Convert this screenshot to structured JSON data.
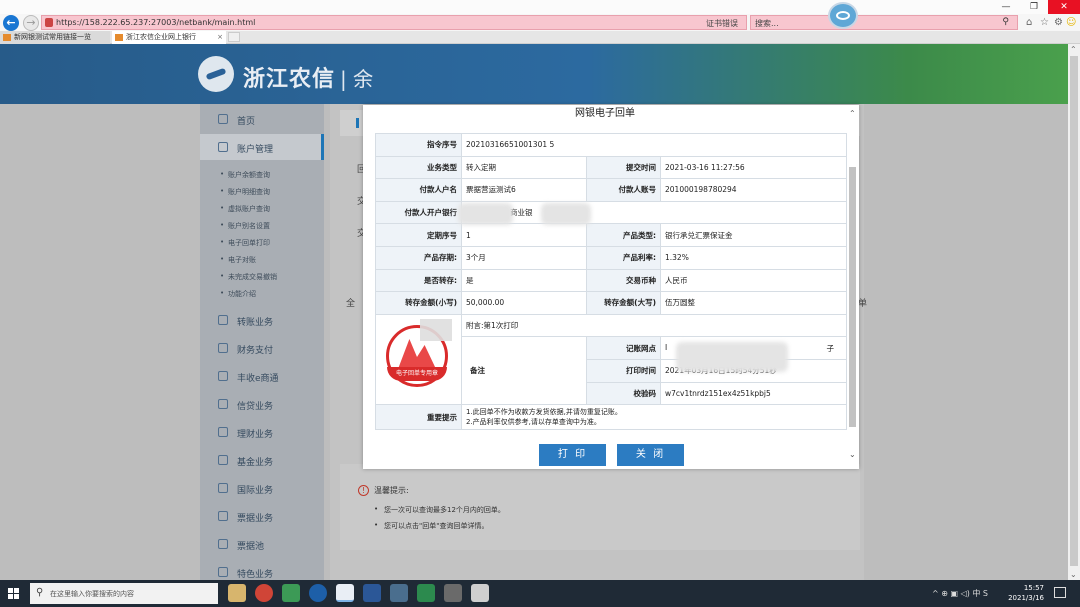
{
  "browser": {
    "url": "https://158.222.65.237:27003/netbank/main.html",
    "cert_text": "证书错误",
    "search_placeholder": "搜索...",
    "tabs": [
      {
        "label": "新网银测试常用链接一览"
      },
      {
        "label": "浙江农信企业网上银行"
      }
    ],
    "window_controls": {
      "min": "—",
      "max": "❐",
      "close": "✕"
    }
  },
  "header": {
    "brand": "浙江农信",
    "sep": "| 余"
  },
  "sidebar": {
    "items": [
      {
        "label": "首页",
        "icon": "home-icon"
      },
      {
        "label": "账户管理",
        "icon": "account-icon",
        "active": true
      },
      {
        "label": "转账业务",
        "icon": "transfer-icon"
      },
      {
        "label": "财务支付",
        "icon": "payment-icon"
      },
      {
        "label": "丰收e商通",
        "icon": "ecommerce-icon"
      },
      {
        "label": "信贷业务",
        "icon": "loan-icon"
      },
      {
        "label": "理财业务",
        "icon": "wealth-icon"
      },
      {
        "label": "基金业务",
        "icon": "fund-icon"
      },
      {
        "label": "国际业务",
        "icon": "globe-icon"
      },
      {
        "label": "票据业务",
        "icon": "bill-icon"
      },
      {
        "label": "票据池",
        "icon": "bill-pool-icon"
      },
      {
        "label": "特色业务",
        "icon": "feature-icon"
      }
    ],
    "subitems": [
      "账户余额查询",
      "账户明细查询",
      "虚拟账户查询",
      "账户别名设置",
      "电子回单打印",
      "电子对账",
      "未完成交易撤销",
      "功能介绍"
    ]
  },
  "background": {
    "labels": [
      "回",
      "交",
      "交",
      "全",
      "单"
    ]
  },
  "tips": {
    "title": "温馨提示:",
    "lines": [
      "您一次可以查询最多12个月内的回单。",
      "您可以点击\"回单\"查询回单详情。"
    ]
  },
  "modal": {
    "title": "网银电子回单",
    "rows": {
      "instr_no_label": "指令序号",
      "instr_no": "20210316651001301 5",
      "biz_type_label": "业务类型",
      "biz_type": "转入定期",
      "submit_time_label": "提交时间",
      "submit_time": "2021-03-16 11:27:56",
      "payer_name_label": "付款人户名",
      "payer_name": "票据营运测试6",
      "payer_acct_label": "付款人账号",
      "payer_acct": "201000198780294",
      "payer_bank_label": "付款人开户银行",
      "payer_bank_a": "商业银",
      "payer_bank_b": "云",
      "term_no_label": "定期序号",
      "term_no": "1",
      "product_type_label": "产品类型:",
      "product_type": "银行承兑汇票保证金",
      "product_term_label": "产品存期:",
      "product_term": "3个月",
      "product_rate_label": "产品利率:",
      "product_rate": "1.32%",
      "rollover_label": "是否转存:",
      "rollover": "是",
      "currency_label": "交易币种",
      "currency": "人民币",
      "amount_small_label": "转存金额(小写)",
      "amount_small": "50,000.00",
      "amount_big_label": "转存金额(大写)",
      "amount_big": "伍万圆整",
      "print_count": "附言:第1次打印",
      "remark_label": "备注",
      "branch_label": "记账网点",
      "branch_a": "I",
      "branch_b": "子",
      "print_time_label": "打印时间",
      "print_time": "2021年03月16日15时54分51秒",
      "verify_label": "校验码",
      "verify": "w7cv1tnrdz151ex4z51kpbj5",
      "important_label": "重要提示",
      "important_1": "1.此回单不作为收款方发货依据,并请勿重复记账。",
      "important_2": "2.产品利率仅供参考,请以存单查询中为准。"
    },
    "seal_text": "电子回单专用章",
    "print_button": "打 印",
    "close_button": "关 闭"
  },
  "taskbar": {
    "search_placeholder": "在这里输入你要搜索的内容",
    "time": "15:57",
    "date": "2021/3/16",
    "tray_icons": "^ ⊕ ▣ ◁) 中 S"
  }
}
